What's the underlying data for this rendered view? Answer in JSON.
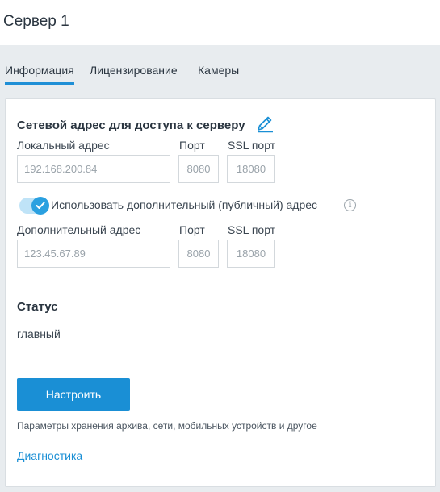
{
  "window": {
    "title": "Сервер 1"
  },
  "tabs": [
    {
      "label": "Информация",
      "active": true
    },
    {
      "label": "Лицензирование",
      "active": false
    },
    {
      "label": "Камеры",
      "active": false
    }
  ],
  "network": {
    "section_title": "Сетевой адрес для доступа к серверу",
    "edit_icon": "pencil-icon",
    "local": {
      "address_label": "Локальный адрес",
      "port_label": "Порт",
      "ssl_port_label": "SSL порт",
      "address_value": "192.168.200.84",
      "port_value": "8080",
      "ssl_port_value": "18080"
    },
    "toggle": {
      "label": "Использовать дополнительный (публичный) адрес",
      "checked": true,
      "info_icon": "info-icon"
    },
    "public": {
      "address_label": "Дополнительный адрес",
      "port_label": "Порт",
      "ssl_port_label": "SSL порт",
      "address_value": "123.45.67.89",
      "port_value": "8080",
      "ssl_port_value": "18080"
    }
  },
  "status": {
    "title": "Статус",
    "value": "главный"
  },
  "actions": {
    "configure_label": "Настроить",
    "configure_hint": "Параметры хранения архива, сети, мобильных устройств и другое",
    "diagnostics_link": "Диагностика"
  },
  "colors": {
    "accent": "#1a8fd5",
    "background": "#e8ecef",
    "toggle_track": "#bfe3f7"
  }
}
